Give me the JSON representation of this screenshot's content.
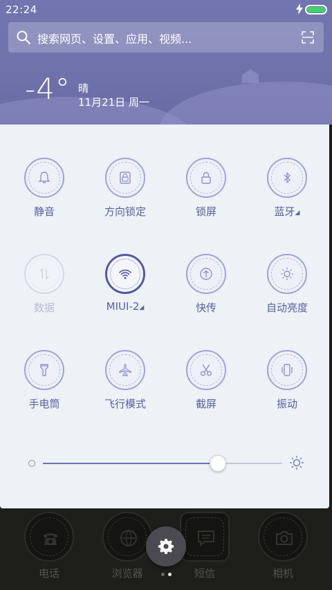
{
  "status_bar": {
    "time": "22:24",
    "charging_icon": "bolt-icon",
    "battery_color": "#3ed36b"
  },
  "search": {
    "placeholder": "搜索网页、设置、应用、视频...",
    "icon": "search-icon",
    "scan_icon": "scan-icon"
  },
  "weather": {
    "temperature": "-4°",
    "condition": "晴",
    "date": "11月21日 周一"
  },
  "toggles": [
    {
      "label": "静音",
      "icon": "bell-icon",
      "state": "off"
    },
    {
      "label": "方向锁定",
      "icon": "rotation-lock-icon",
      "state": "off"
    },
    {
      "label": "锁屏",
      "icon": "lock-icon",
      "state": "off"
    },
    {
      "label": "蓝牙",
      "icon": "bluetooth-icon",
      "state": "off",
      "has_menu": true
    },
    {
      "label": "数据",
      "icon": "mobile-data-icon",
      "state": "disabled"
    },
    {
      "label": "MIUI-2",
      "icon": "wifi-icon",
      "state": "on",
      "has_menu": true
    },
    {
      "label": "快传",
      "icon": "share-icon",
      "state": "off"
    },
    {
      "label": "自动亮度",
      "icon": "auto-brightness-icon",
      "state": "off"
    },
    {
      "label": "手电筒",
      "icon": "flashlight-icon",
      "state": "off"
    },
    {
      "label": "飞行模式",
      "icon": "airplane-icon",
      "state": "off"
    },
    {
      "label": "截屏",
      "icon": "scissors-icon",
      "state": "off"
    },
    {
      "label": "振动",
      "icon": "vibrate-icon",
      "state": "off"
    }
  ],
  "menu_marker": "◢",
  "brightness": {
    "level": 0.73,
    "low_icon": "brightness-low-icon",
    "high_icon": "brightness-high-icon"
  },
  "dock": [
    {
      "label": "电话",
      "icon": "phone-icon"
    },
    {
      "label": "浏览器",
      "icon": "browser-icon"
    },
    {
      "label": "短信",
      "icon": "messages-icon"
    },
    {
      "label": "相机",
      "icon": "camera-icon"
    }
  ],
  "settings_button": {
    "icon": "gear-icon"
  },
  "pager": {
    "pages": 2,
    "current": 1
  },
  "colors": {
    "accent": "#5b5fa2",
    "header": "#7275b0",
    "panel": "#ecf2f5"
  }
}
